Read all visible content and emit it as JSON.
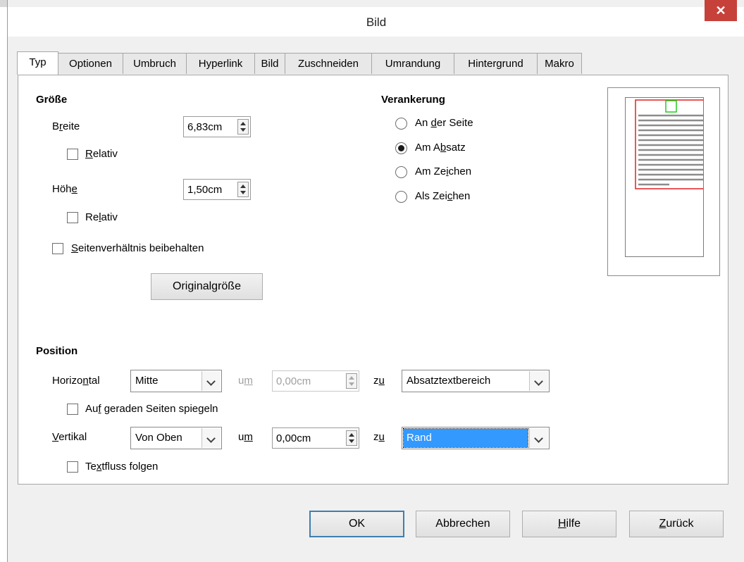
{
  "window": {
    "title": "Bild",
    "close_glyph": "✕"
  },
  "tabs": [
    "Typ",
    "Optionen",
    "Umbruch",
    "Hyperlink",
    "Bild",
    "Zuschneiden",
    "Umrandung",
    "Hintergrund",
    "Makro"
  ],
  "active_tab": "Typ",
  "size": {
    "heading": "Größe",
    "width_label": "Breite",
    "width_value": "6,83cm",
    "width_relative_label": "Relativ",
    "width_relative_checked": false,
    "height_label": "Höhe",
    "height_value": "1,50cm",
    "height_relative_label": "Relativ",
    "height_relative_checked": false,
    "keep_ratio_label": "Seitenverhältnis beibehalten",
    "keep_ratio_checked": false,
    "original_size_button": "Originalgröße"
  },
  "anchor": {
    "heading": "Verankerung",
    "options": [
      {
        "label": "An der Seite",
        "checked": false
      },
      {
        "label": "Am Absatz",
        "checked": true
      },
      {
        "label": "Am Zeichen",
        "checked": false
      },
      {
        "label": "Als Zeichen",
        "checked": false
      }
    ]
  },
  "position": {
    "heading": "Position",
    "horizontal_label": "Horizontal",
    "horizontal_value": "Mitte",
    "by_label": "um",
    "horizontal_by_value": "0,00cm",
    "to_label": "zu",
    "horizontal_to_value": "Absatztextbereich",
    "mirror_label": "Auf geraden Seiten spiegeln",
    "mirror_checked": false,
    "vertical_label": "Vertikal",
    "vertical_value": "Von Oben",
    "vertical_by_value": "0,00cm",
    "vertical_to_value": "Rand",
    "follow_text_label": "Textfluss folgen",
    "follow_text_checked": false
  },
  "buttons": {
    "ok": "OK",
    "cancel": "Abbrechen",
    "help": "Hilfe",
    "back": "Zurück"
  },
  "colors": {
    "close_red": "#c7413b",
    "selection_blue": "#3399ff",
    "preview_frame_red": "#e02020",
    "preview_anchor_green": "#22cc22"
  }
}
